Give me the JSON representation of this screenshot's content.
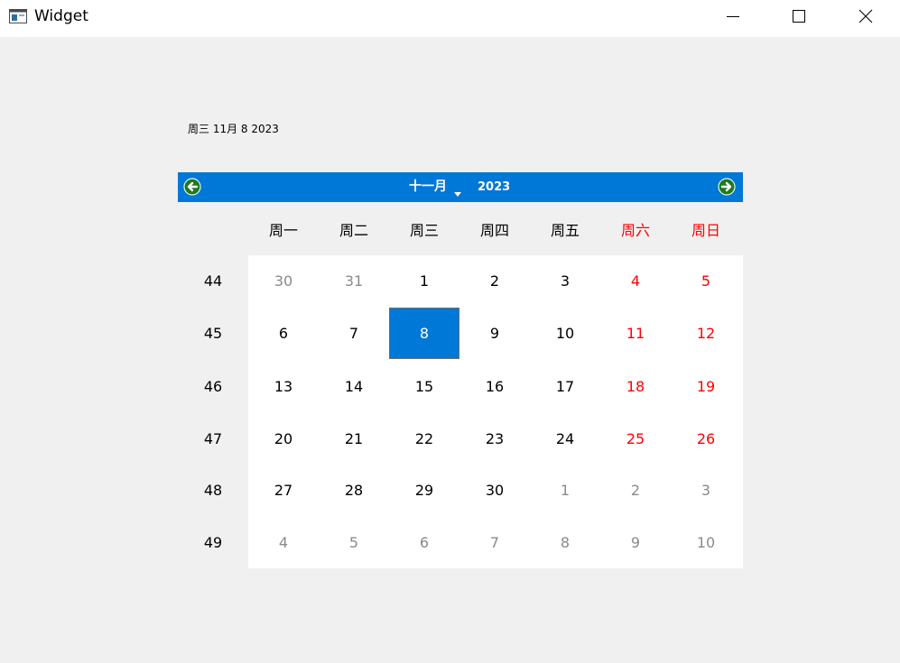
{
  "window": {
    "title": "Widget",
    "icon": "app-window-icon",
    "controls": [
      "minimize-icon",
      "maximize-icon",
      "close-icon"
    ]
  },
  "selected_date_label": "周三 11月 8 2023",
  "calendar": {
    "month_label": "十一月",
    "year_label": "2023",
    "prev_icon": "arrow-left-circle-icon",
    "next_icon": "arrow-right-circle-icon",
    "colors": {
      "nav_bar": "#0078d7",
      "selected": "#0078d7",
      "weekend_text": "#ff0000",
      "other_month_text": "#8a8a8a",
      "arrow_fill": "#1e7a1e"
    },
    "weekdays": [
      "周一",
      "周二",
      "周三",
      "周四",
      "周五",
      "周六",
      "周日"
    ],
    "weeks": [
      {
        "number": "44",
        "days": [
          {
            "label": "30",
            "other": true
          },
          {
            "label": "31",
            "other": true
          },
          {
            "label": "1"
          },
          {
            "label": "2"
          },
          {
            "label": "3"
          },
          {
            "label": "4"
          },
          {
            "label": "5"
          }
        ]
      },
      {
        "number": "45",
        "days": [
          {
            "label": "6"
          },
          {
            "label": "7"
          },
          {
            "label": "8",
            "selected": true
          },
          {
            "label": "9"
          },
          {
            "label": "10"
          },
          {
            "label": "11"
          },
          {
            "label": "12"
          }
        ]
      },
      {
        "number": "46",
        "days": [
          {
            "label": "13"
          },
          {
            "label": "14"
          },
          {
            "label": "15"
          },
          {
            "label": "16"
          },
          {
            "label": "17"
          },
          {
            "label": "18"
          },
          {
            "label": "19"
          }
        ]
      },
      {
        "number": "47",
        "days": [
          {
            "label": "20"
          },
          {
            "label": "21"
          },
          {
            "label": "22"
          },
          {
            "label": "23"
          },
          {
            "label": "24"
          },
          {
            "label": "25"
          },
          {
            "label": "26"
          }
        ]
      },
      {
        "number": "48",
        "days": [
          {
            "label": "27"
          },
          {
            "label": "28"
          },
          {
            "label": "29"
          },
          {
            "label": "30"
          },
          {
            "label": "1",
            "other": true
          },
          {
            "label": "2",
            "other": true
          },
          {
            "label": "3",
            "other": true
          }
        ]
      },
      {
        "number": "49",
        "days": [
          {
            "label": "4",
            "other": true
          },
          {
            "label": "5",
            "other": true
          },
          {
            "label": "6",
            "other": true
          },
          {
            "label": "7",
            "other": true
          },
          {
            "label": "8",
            "other": true
          },
          {
            "label": "9",
            "other": true
          },
          {
            "label": "10",
            "other": true
          }
        ]
      }
    ]
  }
}
